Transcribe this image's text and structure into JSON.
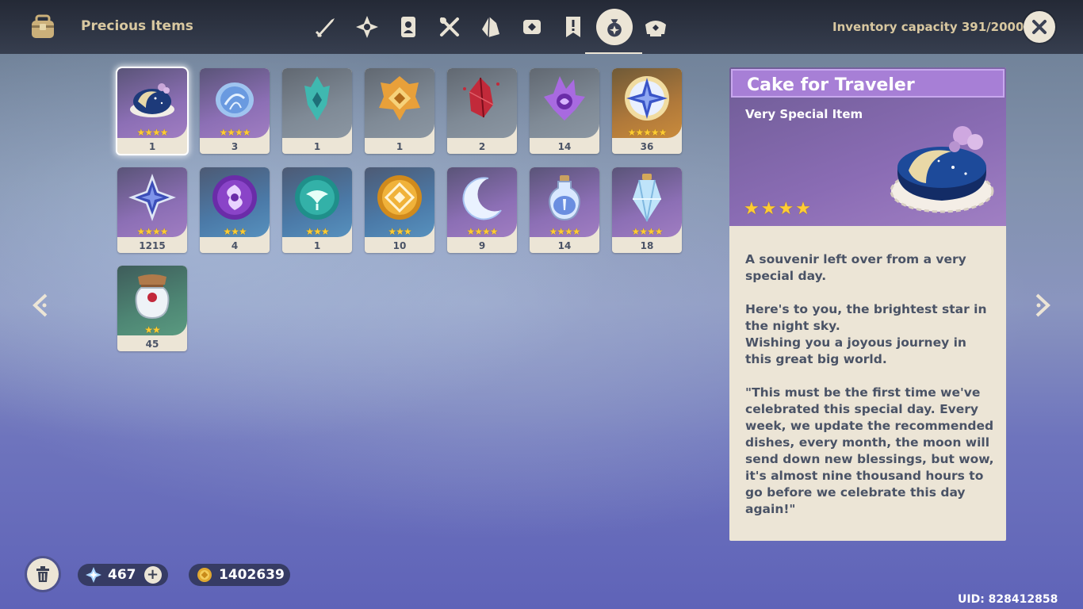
{
  "header": {
    "title": "Precious Items",
    "capacity_text": "Inventory capacity 391/2000",
    "tabs": [
      {
        "icon": "weapon-icon"
      },
      {
        "icon": "artifact-icon"
      },
      {
        "icon": "character-development-icon"
      },
      {
        "icon": "food-icon"
      },
      {
        "icon": "materials-icon"
      },
      {
        "icon": "gadget-icon"
      },
      {
        "icon": "quest-icon"
      },
      {
        "icon": "precious-items-icon",
        "active": true
      },
      {
        "icon": "furnishing-icon"
      }
    ]
  },
  "items": [
    {
      "name": "cake",
      "count": "1",
      "stars": "★★★★",
      "rarity": "r4",
      "icon": "cake-icon",
      "selected": true
    },
    {
      "name": "dream-orb",
      "count": "3",
      "stars": "★★★★",
      "rarity": "r4",
      "icon": "orb-icon"
    },
    {
      "name": "teal-crystal",
      "count": "1",
      "stars": "",
      "rarity": "r1",
      "icon": "teal-crystal-icon"
    },
    {
      "name": "gold-emblem",
      "count": "1",
      "stars": "",
      "rarity": "r1",
      "icon": "gold-emblem-icon"
    },
    {
      "name": "red-shard",
      "count": "2",
      "stars": "",
      "rarity": "r1",
      "icon": "red-shard-icon"
    },
    {
      "name": "purple-crystal",
      "count": "14",
      "stars": "",
      "rarity": "r1",
      "icon": "purple-crystal-icon"
    },
    {
      "name": "intertwined-fate",
      "count": "36",
      "stars": "★★★★★",
      "rarity": "r5",
      "icon": "compass-star-icon"
    },
    {
      "name": "acquaint-fate",
      "count": "1215",
      "stars": "★★★★",
      "rarity": "r4",
      "icon": "blue-star-icon"
    },
    {
      "name": "electro-sigil",
      "count": "4",
      "stars": "★★★",
      "rarity": "r3",
      "icon": "purple-sigil-icon"
    },
    {
      "name": "anemo-sigil",
      "count": "1",
      "stars": "★★★",
      "rarity": "r3",
      "icon": "teal-sigil-icon"
    },
    {
      "name": "geo-sigil",
      "count": "10",
      "stars": "★★★",
      "rarity": "r3",
      "icon": "gold-sigil-icon"
    },
    {
      "name": "crescent",
      "count": "9",
      "stars": "★★★★",
      "rarity": "r4",
      "icon": "crescent-icon"
    },
    {
      "name": "potion",
      "count": "14",
      "stars": "★★★★",
      "rarity": "r4",
      "icon": "potion-icon"
    },
    {
      "name": "ice-crystal",
      "count": "18",
      "stars": "★★★★",
      "rarity": "r4",
      "icon": "ice-crystal-icon"
    },
    {
      "name": "jar",
      "count": "45",
      "stars": "★★",
      "rarity": "r2",
      "icon": "jar-icon"
    }
  ],
  "detail": {
    "title": "Cake for Traveler",
    "type": "Very Special Item",
    "stars": "★★★★",
    "p1": "A souvenir left over from a very special day.",
    "p2": "Here's to you, the brightest star in the night sky.\nWishing you a joyous journey in this great big world.",
    "p3": "\"This must be the first time we've celebrated this special day. Every week, we update the recommended dishes, every month, the moon will send down new blessings, but wow, it's almost nine thousand hours to go before we celebrate this day again!\""
  },
  "footer": {
    "primogems": "467",
    "mora": "1402639",
    "uid": "UID: 828412858"
  },
  "colors": {
    "accent": "#ece5d6",
    "gold_text": "#d9c8a0",
    "title_bar": "#a77fd6",
    "star": "#ffcc33"
  }
}
